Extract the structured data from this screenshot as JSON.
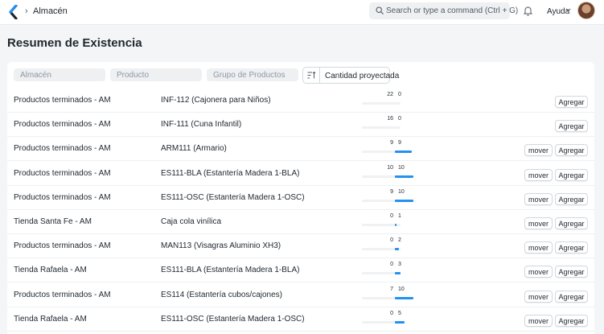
{
  "navbar": {
    "breadcrumb": "Almacén",
    "search_placeholder": "Search or type a command (Ctrl + G)",
    "help_label": "Ayuda"
  },
  "page": {
    "title": "Resumen de Existencia"
  },
  "filters": {
    "warehouse_placeholder": "Almacén",
    "product_placeholder": "Producto",
    "group_placeholder": "Grupo de Productos",
    "sort_label": "Cantidad proyectada"
  },
  "actions": {
    "move_label": "mover",
    "add_label": "Agregar"
  },
  "colors": {
    "bar": "#2490ef",
    "accent": "#2490ef"
  },
  "rows": [
    {
      "warehouse": "Productos terminados - AM",
      "product": "INF-112 (Cajonera para Niños)",
      "actual": "22",
      "projected": "0",
      "has_move": false
    },
    {
      "warehouse": "Productos terminados - AM",
      "product": "INF-111 (Cuna Infantil)",
      "actual": "16",
      "projected": "0",
      "has_move": false
    },
    {
      "warehouse": "Productos terminados - AM",
      "product": "ARM111 (Armario)",
      "actual": "9",
      "projected": "9",
      "has_move": true
    },
    {
      "warehouse": "Productos terminados - AM",
      "product": "ES111-BLA (Estantería Madera 1-BLA)",
      "actual": "10",
      "projected": "10",
      "has_move": true
    },
    {
      "warehouse": "Productos terminados - AM",
      "product": "ES111-OSC (Estantería Madera 1-OSC)",
      "actual": "9",
      "projected": "10",
      "has_move": true
    },
    {
      "warehouse": "Tienda Santa Fe - AM",
      "product": "Caja cola vinílica",
      "actual": "0",
      "projected": "1",
      "has_move": true
    },
    {
      "warehouse": "Productos terminados - AM",
      "product": "MAN113 (Visagras Aluminio XH3)",
      "actual": "0",
      "projected": "2",
      "has_move": true
    },
    {
      "warehouse": "Tienda Rafaela - AM",
      "product": "ES111-BLA (Estantería Madera 1-BLA)",
      "actual": "0",
      "projected": "3",
      "has_move": true
    },
    {
      "warehouse": "Productos terminados - AM",
      "product": "ES114 (Estantería cubos/cajones)",
      "actual": "7",
      "projected": "10",
      "has_move": true
    },
    {
      "warehouse": "Tienda Rafaela - AM",
      "product": "ES111-OSC (Estantería Madera 1-OSC)",
      "actual": "0",
      "projected": "5",
      "has_move": true
    }
  ]
}
